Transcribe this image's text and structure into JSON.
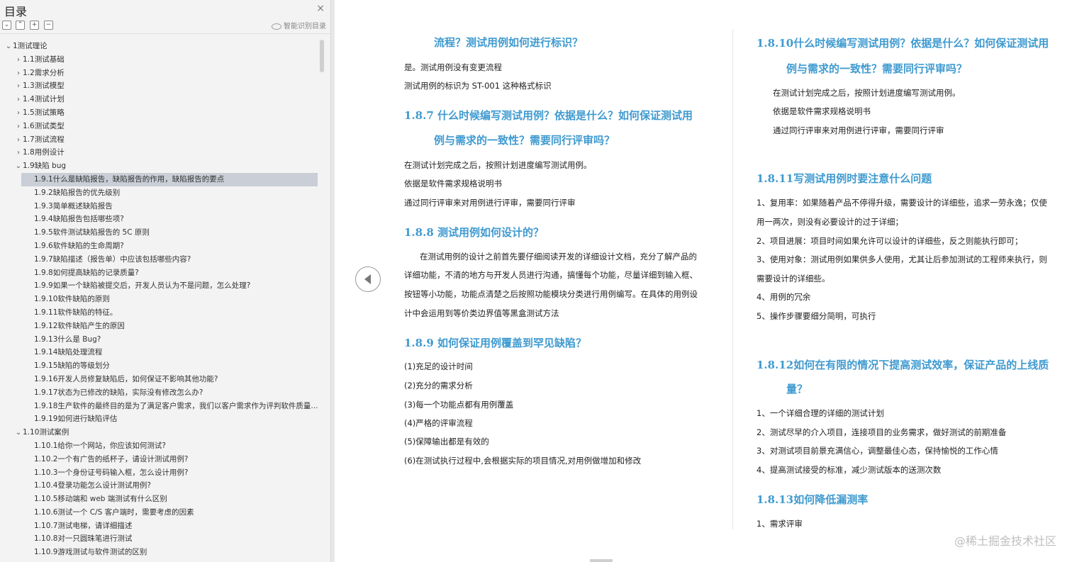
{
  "sidebar": {
    "title": "目录",
    "close_icon": "×",
    "tool_icons": [
      "⌄",
      "⌃",
      "+",
      "−"
    ],
    "smart_label": "智能识别目录",
    "items": [
      {
        "label": "1测试理论",
        "level": 0,
        "arrow": "⌄"
      },
      {
        "label": "1.1测试基础",
        "level": 1,
        "arrow": "›"
      },
      {
        "label": "1.2需求分析",
        "level": 1,
        "arrow": "›"
      },
      {
        "label": "1.3测试模型",
        "level": 1,
        "arrow": "›"
      },
      {
        "label": "1.4测试计划",
        "level": 1,
        "arrow": "›"
      },
      {
        "label": "1.5测试策略",
        "level": 1,
        "arrow": "›"
      },
      {
        "label": "1.6测试类型",
        "level": 1,
        "arrow": "›"
      },
      {
        "label": "1.7测试流程",
        "level": 1,
        "arrow": "›"
      },
      {
        "label": "1.8用例设计",
        "level": 1,
        "arrow": "›"
      },
      {
        "label": "1.9缺陷 bug",
        "level": 1,
        "arrow": "⌄"
      },
      {
        "label": "1.9.1什么是缺陷报告，缺陷报告的作用，缺陷报告的要点",
        "level": 2,
        "selected": true
      },
      {
        "label": "1.9.2缺陷报告的优先级别",
        "level": 2
      },
      {
        "label": "1.9.3简单概述缺陷报告",
        "level": 2
      },
      {
        "label": "1.9.4缺陷报告包括哪些项?",
        "level": 2
      },
      {
        "label": "1.9.5软件测试缺陷报告的 5C 原则",
        "level": 2
      },
      {
        "label": "1.9.6软件缺陷的生命周期?",
        "level": 2
      },
      {
        "label": "1.9.7缺陷描述（报告单）中应该包括哪些内容?",
        "level": 2
      },
      {
        "label": "1.9.8如何提高缺陷的记录质量?",
        "level": 2
      },
      {
        "label": "1.9.9如果一个缺陷被提交后，开发人员认为不是问题，怎么处理?",
        "level": 2
      },
      {
        "label": "1.9.10软件缺陷的原则",
        "level": 2
      },
      {
        "label": "1.9.11软件缺陷的特征。",
        "level": 2
      },
      {
        "label": "1.9.12软件缺陷产生的原因",
        "level": 2
      },
      {
        "label": "1.9.13什么是 Bug?",
        "level": 2
      },
      {
        "label": "1.9.14缺陷处理流程",
        "level": 2
      },
      {
        "label": "1.9.15缺陷的等级划分",
        "level": 2
      },
      {
        "label": "1.9.16开发人员修复缺陷后，如何保证不影响其他功能?",
        "level": 2
      },
      {
        "label": "1.9.17状态为已修改的缺陷，实际没有修改怎么办?",
        "level": 2
      },
      {
        "label": "1.9.18生产软件的最终目的是为了满足客户需求，我们以客户需求作为评判软件质量...",
        "level": 2
      },
      {
        "label": "1.9.19如何进行缺陷评估",
        "level": 2
      },
      {
        "label": "1.10测试案例",
        "level": 1,
        "arrow": "⌄"
      },
      {
        "label": "1.10.1给你一个网站，你应该如何测试?",
        "level": 2
      },
      {
        "label": "1.10.2一个有广告的纸杯子，请设计测试用例?",
        "level": 2
      },
      {
        "label": "1.10.3一个身份证号码输入框，怎么设计用例?",
        "level": 2
      },
      {
        "label": "1.10.4登录功能怎么设计测试用例?",
        "level": 2
      },
      {
        "label": "1.10.5移动端和 web 端测试有什么区别",
        "level": 2
      },
      {
        "label": "1.10.6测试一个 C/S 客户端时，需要考虑的因素",
        "level": 2
      },
      {
        "label": "1.10.7测试电梯，请详细描述",
        "level": 2
      },
      {
        "label": "1.10.8对一只圆珠笔进行测试",
        "level": 2
      },
      {
        "label": "1.10.9游戏测试与软件测试的区别",
        "level": 2
      }
    ]
  },
  "left_col": {
    "h_top": "流程？测试用例如何进行标识？",
    "p1": "是。测试用例没有变更流程",
    "p2": "测试用例的标识为  ST-001  这种格式标识",
    "h_187_a": "1.8.7  什么时候编写测试用例？依据是什么？如何保证测试用",
    "h_187_b": "例与需求的一致性？需要同行评审吗？",
    "p3": "在测试计划完成之后，按照计划进度编写测试用例。",
    "p4": "依据是软件需求规格说明书",
    "p5": "通过同行评审来对用例进行评审，需要同行评审",
    "h_188": "1.8.8  测试用例如何设计的？",
    "p6": "在测试用例的设计之前首先要仔细阅读开发的详细设计文档，充分了解产品的",
    "p7": "详细功能，不清的地方与开发人员进行沟通，搞懂每个功能，尽量详细到输入框、",
    "p8": "按钮等小功能，功能点清楚之后按照功能模块分类进行用例编写。在具体的用例设",
    "p9": "计中会运用到等价类边界值等黑盒测试方法",
    "h_189": "1.8.9  如何保证用例覆盖到罕见缺陷？",
    "l1": "(1)充足的设计时间",
    "l2": "(2)充分的需求分析",
    "l3": "(3)每一个功能点都有用例覆盖",
    "l4": "(4)严格的评审流程",
    "l5": "(5)保障输出都是有效的",
    "l6": "(6)在测试执行过程中,会根据实际的项目情况,对用例做增加和修改"
  },
  "right_col": {
    "h_1810_a": "1.8.10什么时候编写测试用例？依据是什么？如何保证测试用",
    "h_1810_b": "例与需求的一致性？需要同行评审吗？",
    "p1": "在测试计划完成之后，按照计划进度编写测试用例。",
    "p2": "依据是软件需求规格说明书",
    "p3": "通过同行评审来对用例进行评审，需要同行评审",
    "h_1811": "1.8.11写测试用例时要注意什么问题",
    "q1": "1、复用率：如果随着产品不停得升级，需要设计的详细些，追求一劳永逸；仅使",
    "q1b": "用一两次，则没有必要设计的过于详细；",
    "q2": "2、项目进展：项目时间如果允许可以设计的详细些，反之则能执行即可；",
    "q3": "3、使用对象：测试用例如果供多人使用，尤其让后参加测试的工程师来执行，则",
    "q3b": "需要设计的详细些。",
    "q4": "4、用例的冗余",
    "q5": "5、操作步骤要细分简明，可执行",
    "h_1812_a": "1.8.12如何在有限的情况下提高测试效率，保证产品的上线质",
    "h_1812_b": "量？",
    "r1": "1、一个详细合理的详细的测试计划",
    "r2": "2、测试尽早的介入项目，连接项目的业务需求，做好测试的前期准备",
    "r3": "3、对测试项目前景充满信心，调整最佳心态，保持愉悦的工作心情",
    "r4": "4、提高测试接受的标准，减少测试版本的送测次数",
    "h_1813": "1.8.13如何降低漏测率",
    "s1": "1、需求评审"
  },
  "watermark": "@稀土掘金技术社区"
}
